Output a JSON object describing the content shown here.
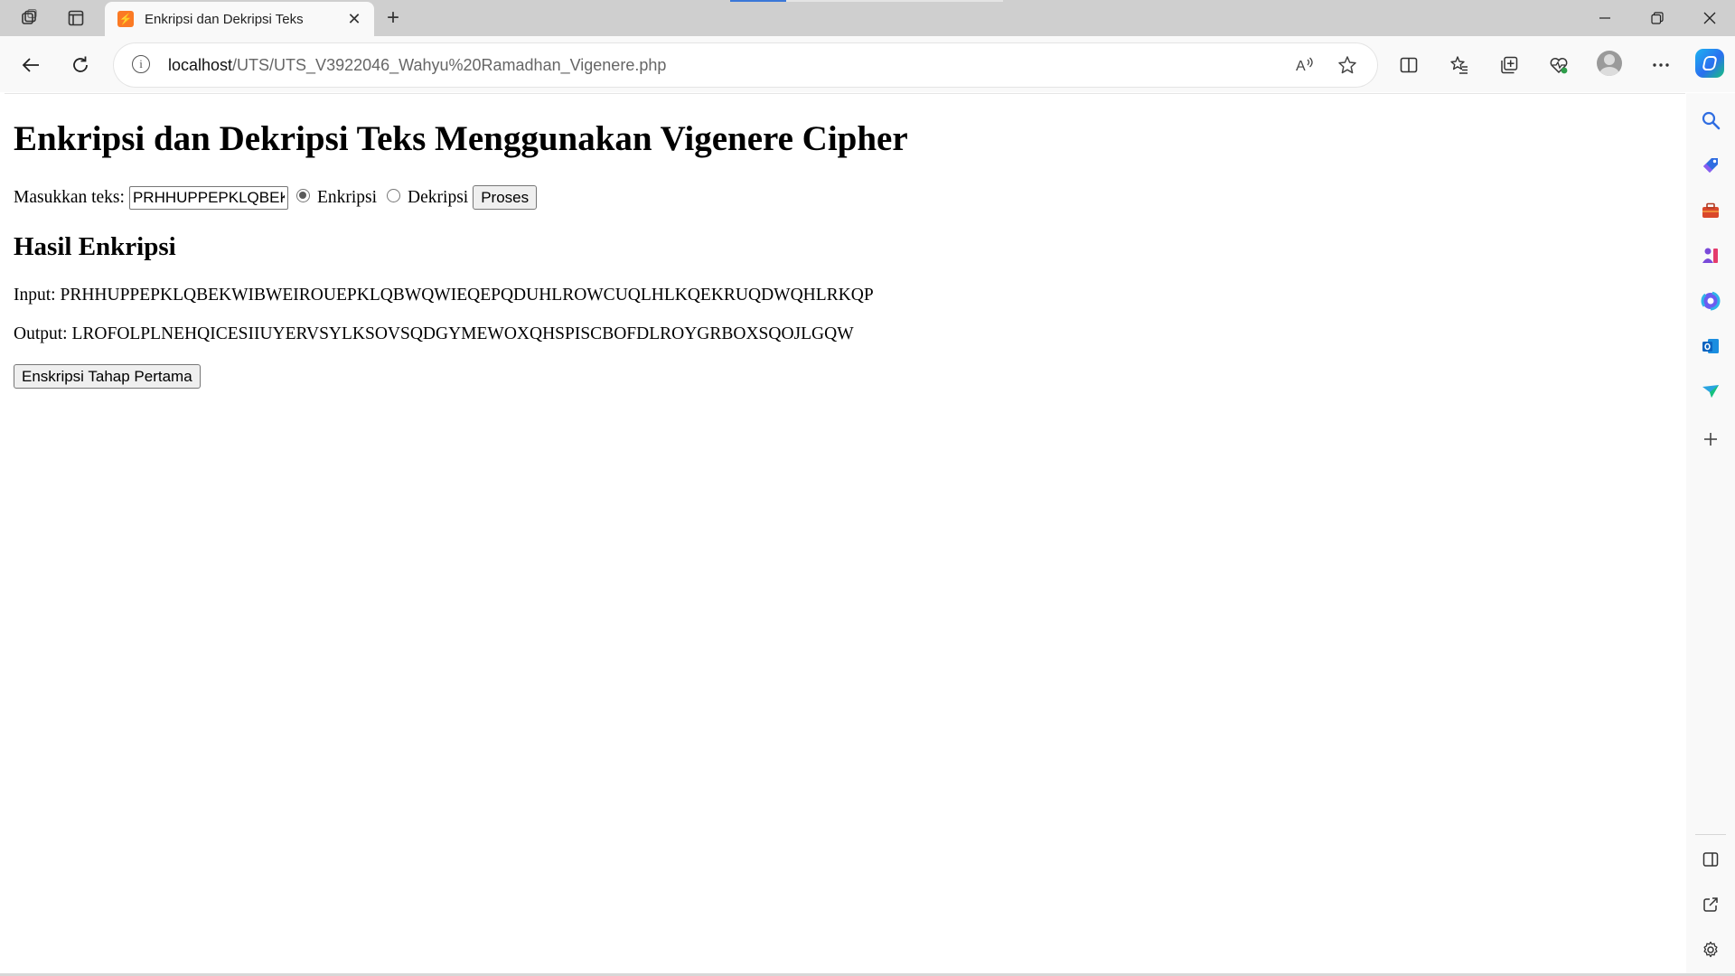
{
  "browser": {
    "tab_title": "Enkripsi dan Dekripsi Teks",
    "tab_favicon_glyph": "⚡",
    "new_tab_glyph": "+",
    "url_host": "localhost",
    "url_path": "/UTS/UTS_V3922046_Wahyu%20Ramadhan_Vigenere.php",
    "icons": {
      "workspaces": "workspaces-icon",
      "tab_actions": "tab-actions-icon",
      "close_tab": "close-icon",
      "back": "back-arrow-icon",
      "refresh": "refresh-icon",
      "site_info": "info-icon",
      "read_aloud": "read-aloud-icon",
      "favorite": "star-icon",
      "split_screen": "split-screen-icon",
      "favorites": "favorites-icon",
      "collections": "collections-icon",
      "browser_essentials": "heart-pulse-icon",
      "profile": "profile-avatar-icon",
      "more": "more-icon",
      "copilot": "copilot-icon"
    }
  },
  "page": {
    "title": "Enkripsi dan Dekripsi Teks Menggunakan Vigenere Cipher",
    "input_label": "Masukkan teks:",
    "input_value": "PRHHUPPEPKLQBEKWIB",
    "radio_encrypt_label": "Enkripsi",
    "radio_decrypt_label": "Dekripsi",
    "selected_mode": "Enkripsi",
    "process_button": "Proses",
    "result_heading": "Hasil Enkripsi",
    "input_prefix": "Input:",
    "input_text": "PRHHUPPEPKLQBEKWIBWEIROUEPKLQBWQWIEQEPQDUHLROWCUQLHLKQEKRUQDWQHLRKQP",
    "output_prefix": "Output:",
    "output_text": "LROFOLPLNEHQICESIIUYERVSYLKSOVSQDGYMEWOXQHSPISCBOFDLROYGRBOXSQOJLGQW",
    "stage_button": "Enskripsi Tahap Pertama"
  },
  "sidebar": {
    "items": [
      "search-icon",
      "tag-icon",
      "toolbox-icon",
      "games-icon",
      "microsoft-365-icon",
      "outlook-icon",
      "drop-icon",
      "add-icon"
    ],
    "bottom_items": [
      "sidebar-toggle-icon",
      "external-link-icon",
      "settings-icon"
    ]
  },
  "colors": {
    "tab_strip": "#cfcfcf",
    "toolbar": "#f9f9f9",
    "favicon": "#fb7a24",
    "accent": "#3b78d8"
  }
}
